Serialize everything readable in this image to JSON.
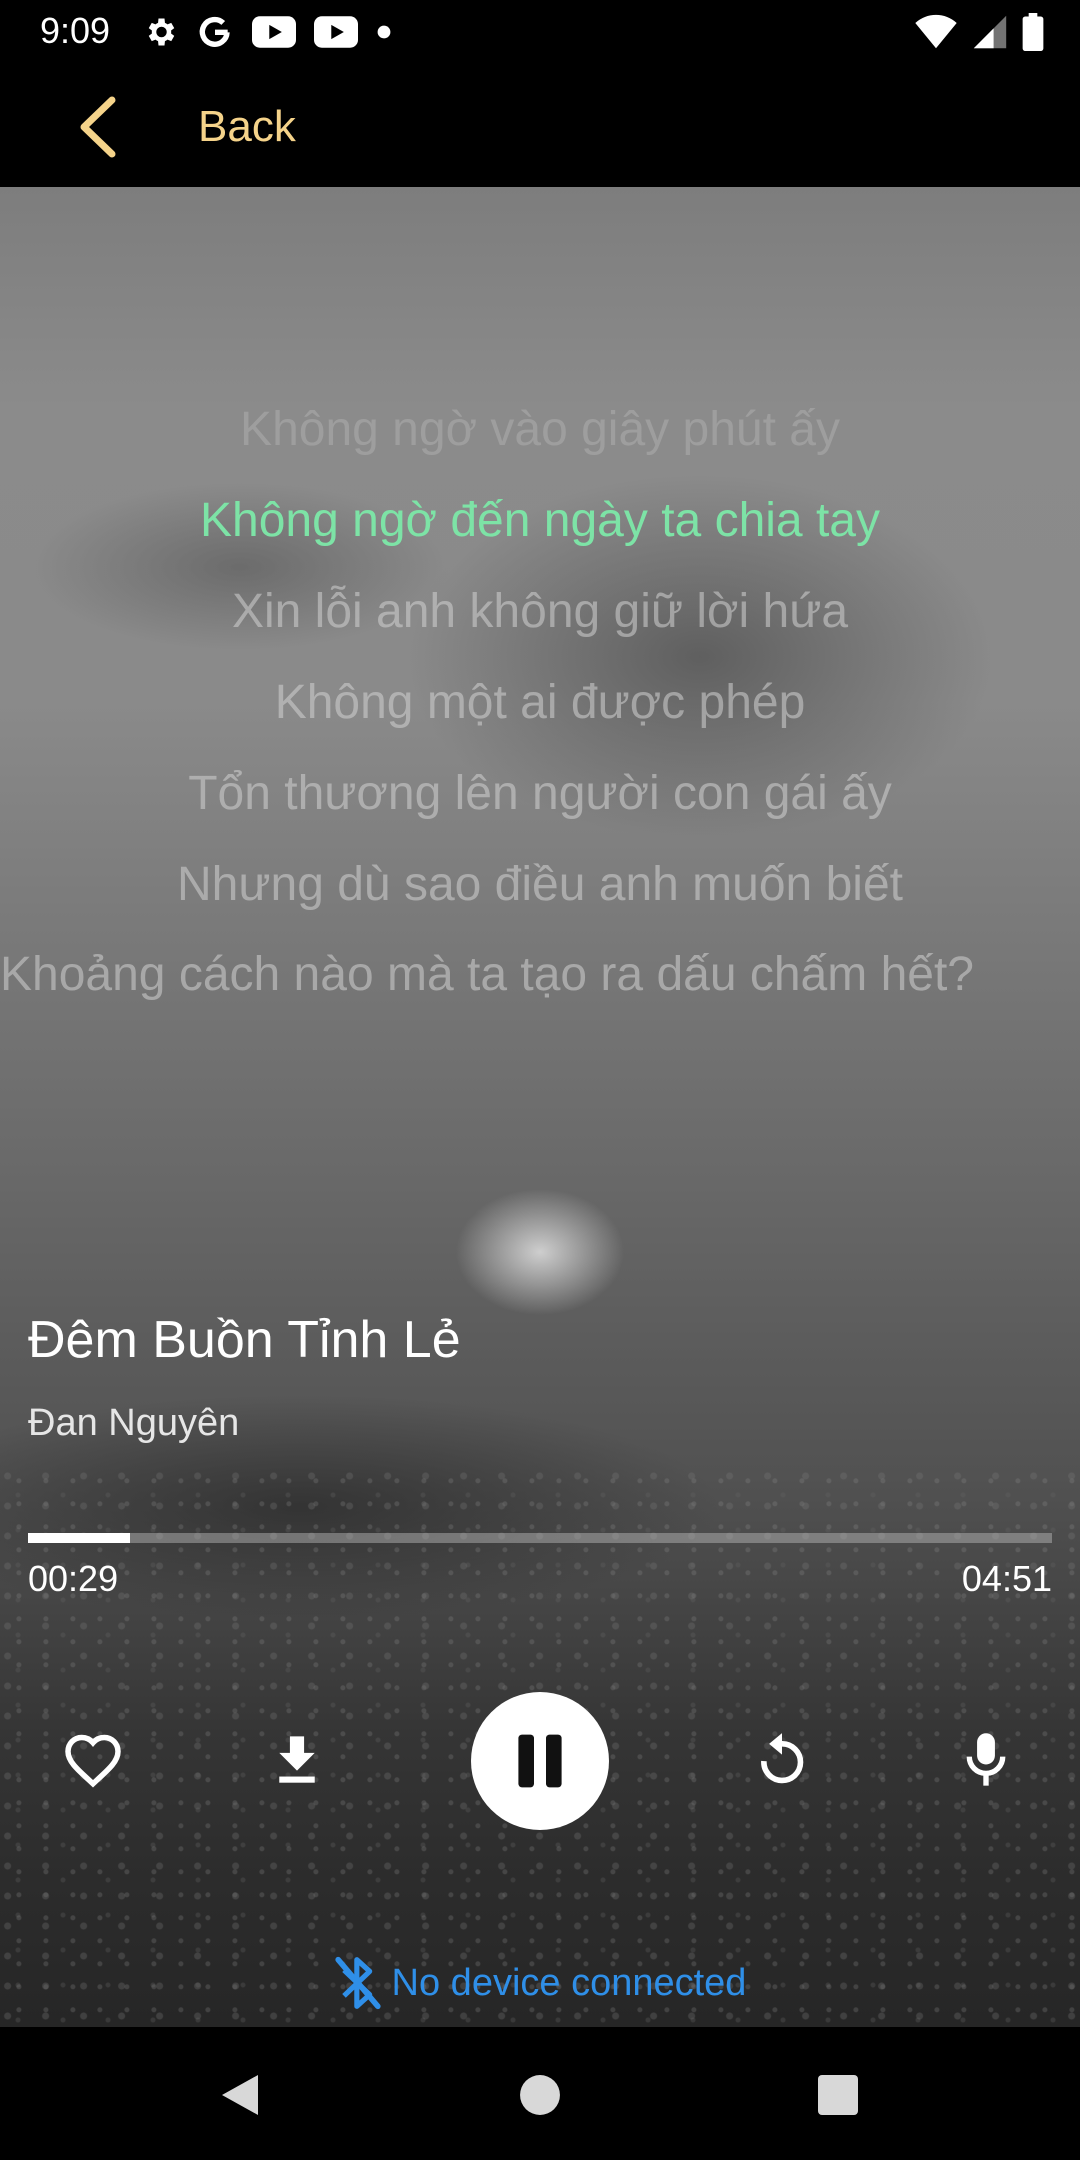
{
  "status_bar": {
    "time": "9:09",
    "left_icons": [
      "gear-icon",
      "google-icon",
      "youtube-icon",
      "youtube-icon",
      "dot-icon"
    ],
    "right_icons": [
      "wifi-icon",
      "cell-signal-icon",
      "battery-icon"
    ]
  },
  "top_bar": {
    "back_label": "Back",
    "accent_color": "#f5d38a"
  },
  "lyrics": {
    "lines": [
      "Không ngờ vào giây phút ấy",
      "Không ngờ đến ngày ta chia tay",
      "Xin lỗi anh không giữ lời hứa",
      "Không một ai được phép",
      "Tổn thương lên người con gái ấy",
      "Nhưng dù sao điều anh muốn biết",
      "Khoảng cách nào mà ta tạo ra dấu chấm hết?"
    ],
    "active_index": 1,
    "active_color": "#7de3a6"
  },
  "track": {
    "title": "Đêm Buồn Tỉnh Lẻ",
    "artist": "Đan Nguyên"
  },
  "progress": {
    "elapsed": "00:29",
    "total": "04:51",
    "fraction": 0.0997
  },
  "controls": {
    "favorite": "heart-icon",
    "download": "download-icon",
    "play_pause": "pause-icon",
    "repeat": "replay-icon",
    "karaoke": "microphone-icon"
  },
  "bluetooth": {
    "status": "No device connected",
    "color": "#2f8fe8"
  },
  "nav_bar": {
    "buttons": [
      "back-triangle-icon",
      "home-circle-icon",
      "recents-square-icon"
    ]
  }
}
